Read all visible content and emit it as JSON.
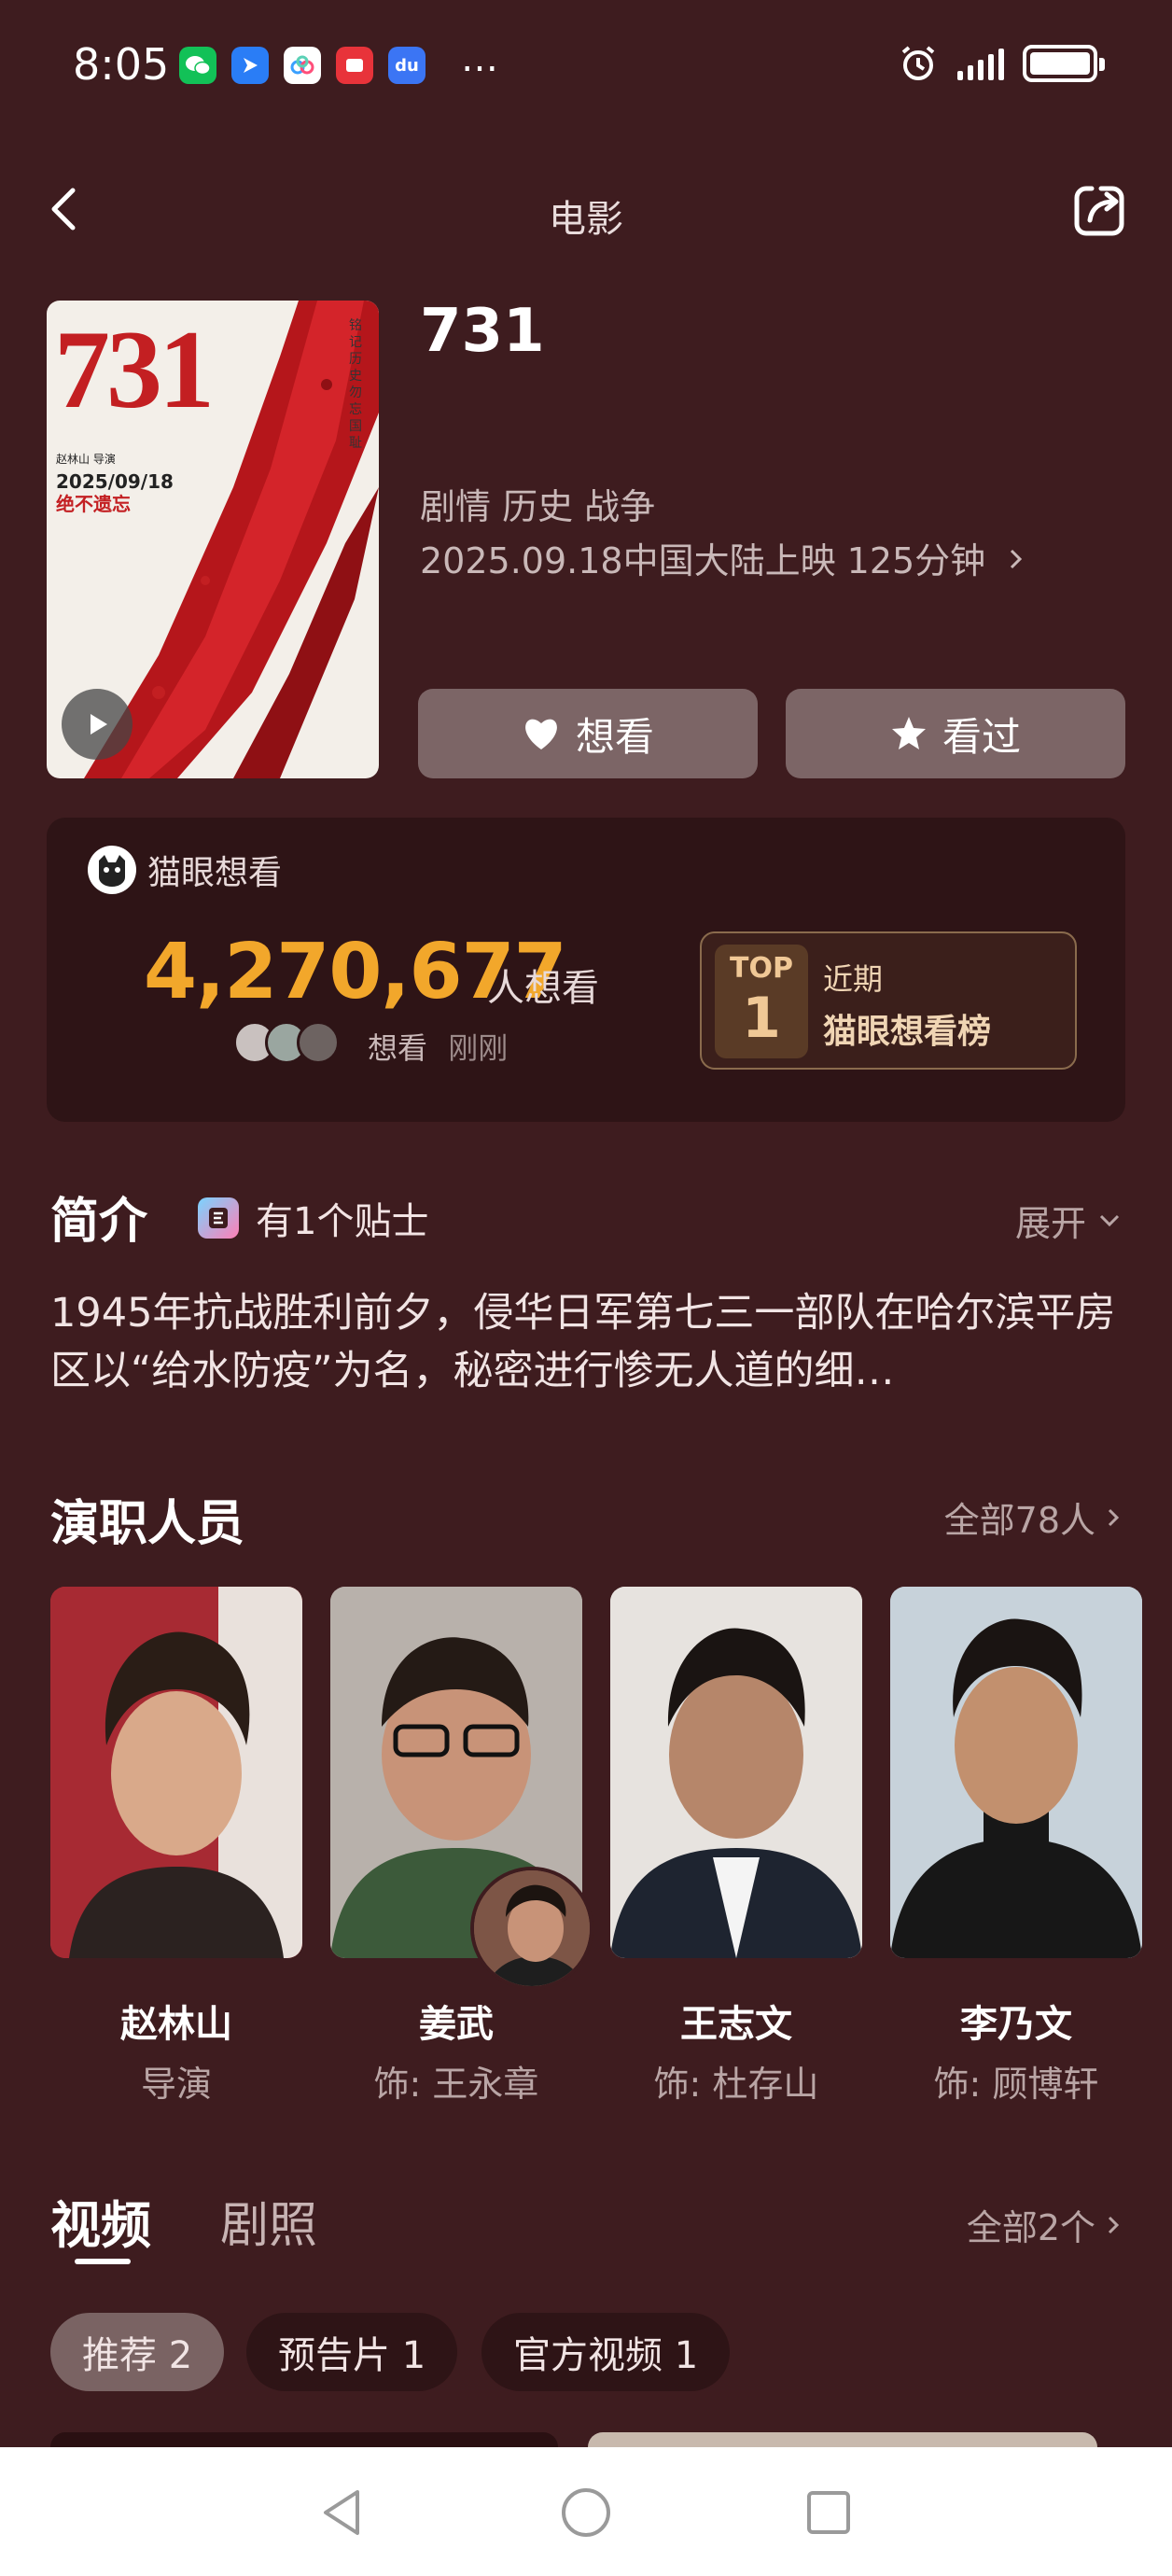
{
  "status_bar": {
    "time": "8:05",
    "more": "…",
    "apps": [
      {
        "icon": "wechat-icon",
        "color": "#12c157",
        "glyph": "●"
      },
      {
        "icon": "feishu-icon",
        "color": "#2a7df6",
        "glyph": "▶"
      },
      {
        "icon": "baidu-netdisk-icon",
        "color": "#ffffff",
        "glyph": "○"
      },
      {
        "icon": "red-app-icon",
        "color": "#e8333a",
        "glyph": "■"
      },
      {
        "icon": "baidu-icon",
        "color": "#3b75f4",
        "glyph": "du"
      }
    ]
  },
  "header": {
    "title": "电影",
    "back_icon": "chevron-left-icon",
    "share_icon": "share-icon"
  },
  "movie": {
    "poster_title": "731",
    "poster_director": "赵林山 导演",
    "poster_date": "2025/09/18",
    "poster_tagline": "绝不遗忘",
    "poster_side": "铭记历史 勿忘国耻",
    "name": "731",
    "genres": "剧情 历史 战争",
    "release": "2025.09.18中国大陆上映 125分钟",
    "want_button": "想看",
    "seen_button": "看过"
  },
  "want": {
    "source": "猫眼想看",
    "count": "4,270,677",
    "unit": "人想看",
    "meta_action": "想看",
    "meta_time": "刚刚",
    "rank_top": "TOP",
    "rank_num": "1",
    "rank_label1": "近期",
    "rank_label2": "猫眼想看榜"
  },
  "synopsis": {
    "title": "简介",
    "tip": "有1个贴士",
    "expand": "展开",
    "text": "1945年抗战胜利前夕，侵华日军第七三一部队在哈尔滨平房区以“给水防疫”为名，秘密进行惨无人道的细…"
  },
  "cast": {
    "title": "演职人员",
    "all": "全部78人",
    "members": [
      {
        "name": "赵林山",
        "role": "导演"
      },
      {
        "name": "姜武",
        "role": "饰: 王永章"
      },
      {
        "name": "王志文",
        "role": "饰: 杜存山"
      },
      {
        "name": "李乃文",
        "role": "饰: 顾博轩"
      }
    ]
  },
  "videos": {
    "tab_videos": "视频",
    "tab_stills": "剧照",
    "all": "全部2个",
    "chips": [
      "推荐 2",
      "预告片 1",
      "官方视频 1"
    ]
  },
  "colors": {
    "background": "#3e1c1f",
    "accent_orange": "#f2a72b",
    "button_bg": "#7c6566",
    "card_bg": "#2e1416"
  }
}
